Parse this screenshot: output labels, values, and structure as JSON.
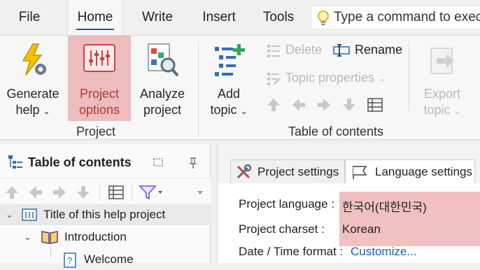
{
  "menu": {
    "tabs": [
      "File",
      "Home",
      "Write",
      "Insert",
      "Tools"
    ],
    "active": "Home",
    "command_search_placeholder": "Type a command to exec"
  },
  "ribbon": {
    "generate_help": {
      "line1": "Generate",
      "line2": "help"
    },
    "project_options": {
      "line1": "Project",
      "line2": "options"
    },
    "analyze_project": {
      "line1": "Analyze",
      "line2": "project"
    },
    "project_group_label": "Project",
    "add_topic": {
      "line1": "Add",
      "line2": "topic"
    },
    "delete_label": "Delete",
    "rename_label": "Rename",
    "topic_properties_label": "Topic properties",
    "toc_group_label": "Table of contents",
    "export_topic": {
      "line1": "Export",
      "line2": "topic"
    }
  },
  "toc_pane": {
    "title": "Table of contents",
    "items": [
      {
        "label": "Title of this help project"
      },
      {
        "label": "Introduction"
      },
      {
        "label": "Welcome"
      }
    ]
  },
  "settings_pane": {
    "tabs": [
      {
        "label": "Project settings"
      },
      {
        "label": "Language settings"
      }
    ],
    "fields": {
      "project_language_label": "Project language :",
      "project_language_value": "한국어(대한민국)",
      "project_charset_label": "Project charset :",
      "project_charset_value": "Korean",
      "datetime_format_label": "Date / Time format :",
      "datetime_format_link": "Customize..."
    }
  },
  "colors": {
    "highlight": "#e68c8c",
    "accent": "#2b579a",
    "link": "#1b5fb8"
  }
}
